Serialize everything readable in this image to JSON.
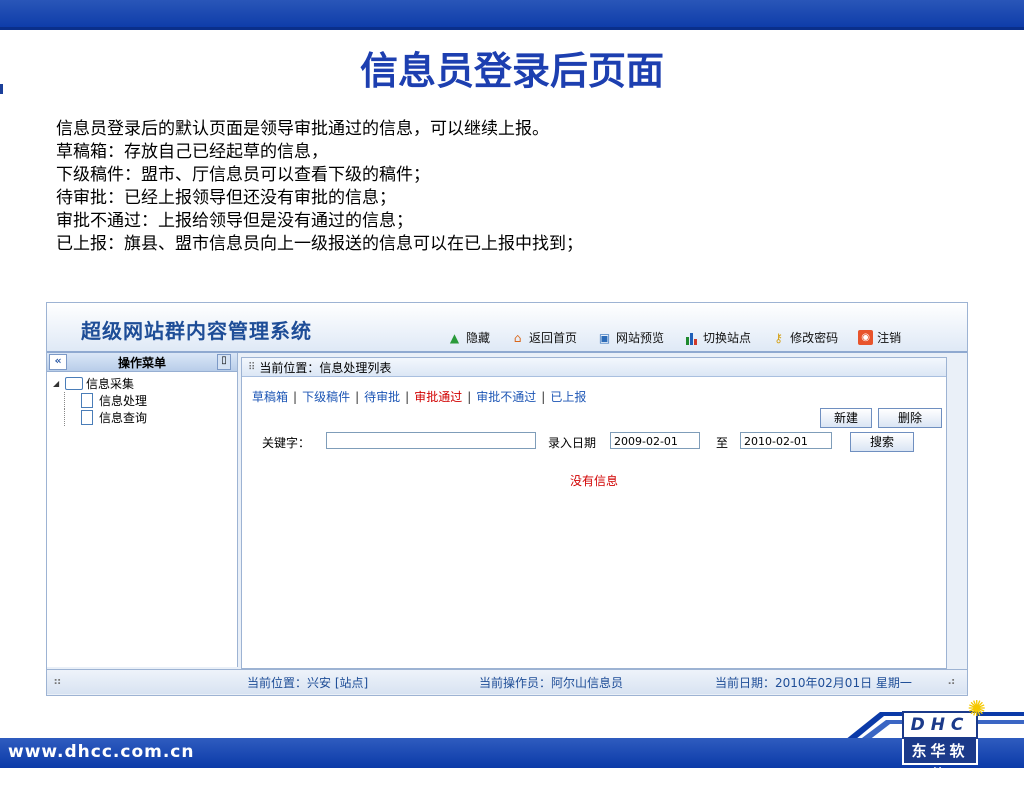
{
  "slide": {
    "title": "信息员登录后页面",
    "description": [
      "信息员登录后的默认页面是领导审批通过的信息，可以继续上报。",
      "草稿箱：存放自己已经起草的信息，",
      "下级稿件：盟市、厅信息员可以查看下级的稿件；",
      "待审批：已经上报领导但还没有审批的信息；",
      "审批不通过：上报给领导但是没有通过的信息；",
      "已上报：旗县、盟市信息员向上一级报送的信息可以在已上报中找到；"
    ],
    "footer_url": "www.dhcc.com.cn",
    "logo_top": "DHC",
    "logo_bottom": "东华软件"
  },
  "app": {
    "title": "超级网站群内容管理系统",
    "toolbar": [
      {
        "label": "隐藏",
        "icon": "hide-arrow-icon"
      },
      {
        "label": "返回首页",
        "icon": "home-icon"
      },
      {
        "label": "网站预览",
        "icon": "preview-icon"
      },
      {
        "label": "切换站点",
        "icon": "switch-site-icon"
      },
      {
        "label": "修改密码",
        "icon": "key-icon"
      },
      {
        "label": "注销",
        "icon": "logout-icon"
      }
    ],
    "menu": {
      "header": "操作菜单",
      "collapse_glyph": "«",
      "tree": {
        "root": "信息采集",
        "children": [
          "信息处理",
          "信息查询"
        ]
      }
    },
    "main": {
      "location": "当前位置：信息处理列表",
      "tabs": [
        "草稿箱",
        "下级稿件",
        "待审批",
        "审批通过",
        "审批不通过",
        "已上报"
      ],
      "active_tab": "审批通过",
      "buttons": {
        "new": "新建",
        "delete": "删除",
        "search": "搜索"
      },
      "keyword_label": "关键字：",
      "keyword_value": "",
      "date_label": "录入日期",
      "date_from": "2009-02-01",
      "date_to_label": "至",
      "date_to": "2010-02-01",
      "empty_message": "没有信息"
    },
    "status": {
      "location": "当前位置：兴安 [站点]",
      "operator": "当前操作员：阿尔山信息员",
      "date": "当前日期：2010年02月01日 星期一"
    }
  },
  "colors": {
    "band": "#0b3aa8",
    "title": "#1d3fb0",
    "link": "#1d56b5",
    "active": "#d10000"
  }
}
